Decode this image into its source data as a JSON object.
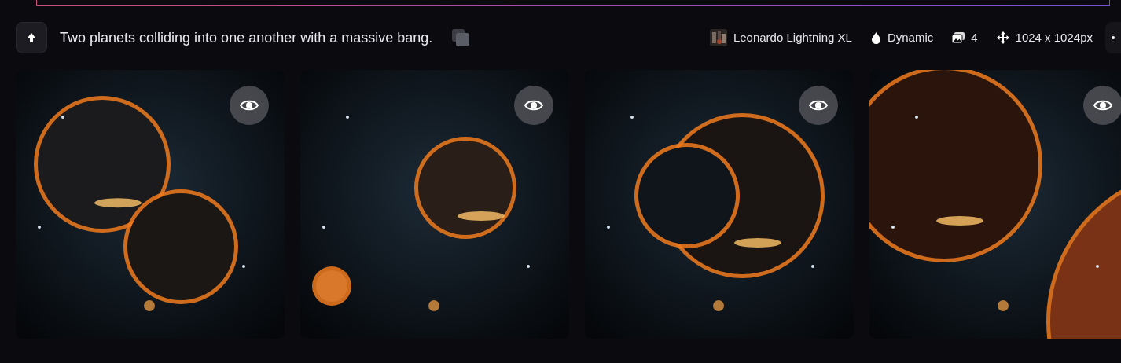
{
  "prompt": {
    "text": "Two planets colliding into one another with a massive bang."
  },
  "meta": [
    {
      "kind": "model",
      "label": "Leonardo Lightning XL"
    },
    {
      "kind": "style",
      "label": "Dynamic"
    },
    {
      "kind": "count",
      "label": "4"
    },
    {
      "kind": "size",
      "label": "1024 x 1024px"
    }
  ]
}
